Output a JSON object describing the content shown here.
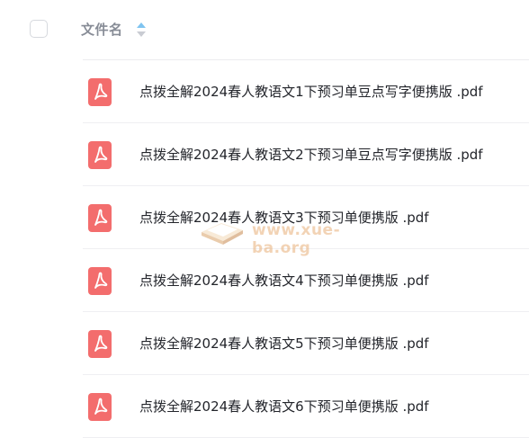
{
  "header": {
    "column_title": "文件名",
    "sort_icon": "sort-icon",
    "colors": {
      "sort_up": "#7fc4f0",
      "sort_down": "#c9ccd3"
    }
  },
  "files": [
    {
      "name": "点拨全解2024春人教语文1下预习单豆点写字便携版 .pdf",
      "icon": "pdf-icon"
    },
    {
      "name": "点拨全解2024春人教语文2下预习单豆点写字便携版 .pdf",
      "icon": "pdf-icon"
    },
    {
      "name": "点拨全解2024春人教语文3下预习单便携版 .pdf",
      "icon": "pdf-icon"
    },
    {
      "name": "点拨全解2024春人教语文4下预习单便携版 .pdf",
      "icon": "pdf-icon"
    },
    {
      "name": "点拨全解2024春人教语文5下预习单便携版 .pdf",
      "icon": "pdf-icon"
    },
    {
      "name": "点拨全解2024春人教语文6下预习单便携版 .pdf",
      "icon": "pdf-icon"
    }
  ],
  "watermark": {
    "text": "www.xue-ba.org"
  },
  "colors": {
    "pdf_icon": "#f36d6d",
    "text": "#23252b",
    "header_text": "#878c96"
  }
}
